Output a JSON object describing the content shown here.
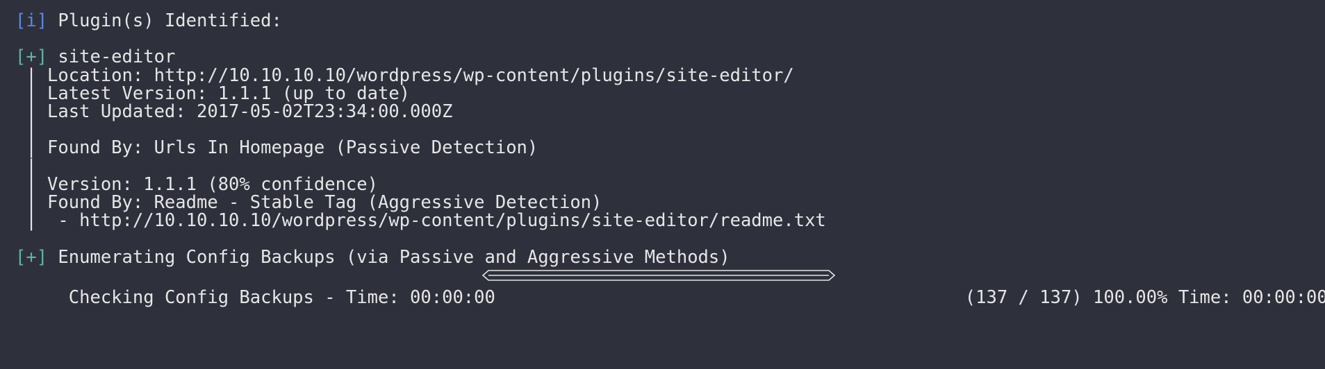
{
  "terminal": {
    "lines": [
      {
        "id": "l0",
        "tag": "[i]",
        "tag_kind": "info",
        "text": " Plugin(s) Identified:"
      },
      {
        "id": "l1",
        "tag": "",
        "tag_kind": "",
        "text": ""
      },
      {
        "id": "l2",
        "tag": "[+]",
        "tag_kind": "plus",
        "text": " site-editor"
      },
      {
        "id": "l3",
        "tag": "",
        "tag_kind": "",
        "text": " | Location: http://10.10.10.10/wordpress/wp-content/plugins/site-editor/"
      },
      {
        "id": "l4",
        "tag": "",
        "tag_kind": "",
        "text": " | Latest Version: 1.1.1 (up to date)"
      },
      {
        "id": "l5",
        "tag": "",
        "tag_kind": "",
        "text": " | Last Updated: 2017-05-02T23:34:00.000Z"
      },
      {
        "id": "l6",
        "tag": "",
        "tag_kind": "",
        "text": " |"
      },
      {
        "id": "l7",
        "tag": "",
        "tag_kind": "",
        "text": " | Found By: Urls In Homepage (Passive Detection)"
      },
      {
        "id": "l8",
        "tag": "",
        "tag_kind": "",
        "text": " |"
      },
      {
        "id": "l9",
        "tag": "",
        "tag_kind": "",
        "text": " | Version: 1.1.1 (80% confidence)"
      },
      {
        "id": "l10",
        "tag": "",
        "tag_kind": "",
        "text": " | Found By: Readme - Stable Tag (Aggressive Detection)"
      },
      {
        "id": "l11",
        "tag": "",
        "tag_kind": "",
        "text": " |  - http://10.10.10.10/wordpress/wp-content/plugins/site-editor/readme.txt"
      },
      {
        "id": "l12",
        "tag": "",
        "tag_kind": "",
        "text": ""
      },
      {
        "id": "l13",
        "tag": "[+]",
        "tag_kind": "plus",
        "text": " Enumerating Config Backups (via Passive and Aggressive Methods)"
      }
    ],
    "progress": {
      "label": " Checking Config Backups - Time: 00:00:00 ",
      "status": " (137 / 137) 100.00% Time: 00:00:00",
      "fraction": 1.0
    },
    "colors": {
      "background": "#2e313b",
      "text": "#e6e6e6",
      "info_tag": "#5b86e5",
      "plus_tag": "#5fb3a8"
    }
  }
}
